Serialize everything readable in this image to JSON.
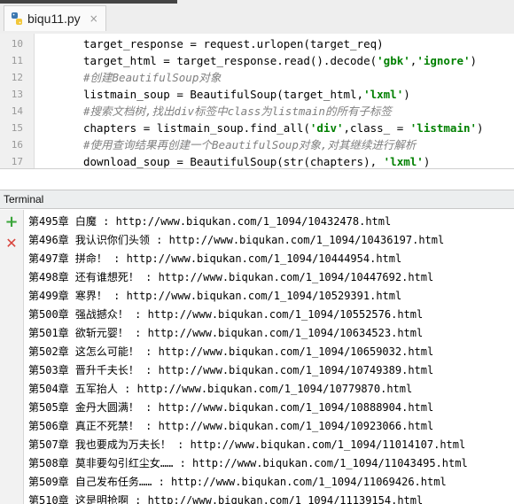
{
  "tab": {
    "filename": "biqu11.py",
    "close_symbol": "×"
  },
  "editor": {
    "lines": [
      {
        "num": "10",
        "parts": [
          {
            "t": "target_response = request.urlopen(target_req)",
            "k": "fn"
          }
        ]
      },
      {
        "num": "11",
        "parts": [
          {
            "t": "target_html = target_response.read().decode(",
            "k": "fn"
          },
          {
            "t": "'gbk'",
            "k": "s"
          },
          {
            "t": ",",
            "k": "fn"
          },
          {
            "t": "'ignore'",
            "k": "s"
          },
          {
            "t": ")",
            "k": "fn"
          }
        ]
      },
      {
        "num": "12",
        "parts": [
          {
            "t": "#创建BeautifulSoup对象",
            "k": "c"
          }
        ]
      },
      {
        "num": "13",
        "parts": [
          {
            "t": "listmain_soup = BeautifulSoup(target_html,",
            "k": "fn"
          },
          {
            "t": "'lxml'",
            "k": "s"
          },
          {
            "t": ")",
            "k": "fn"
          }
        ]
      },
      {
        "num": "14",
        "parts": [
          {
            "t": "#搜索文档树,找出div标签中class为listmain的所有子标签",
            "k": "c"
          }
        ]
      },
      {
        "num": "15",
        "parts": [
          {
            "t": "chapters = listmain_soup.find_all(",
            "k": "fn"
          },
          {
            "t": "'div'",
            "k": "s"
          },
          {
            "t": ",class_ = ",
            "k": "fn"
          },
          {
            "t": "'listmain'",
            "k": "s"
          },
          {
            "t": ")",
            "k": "fn"
          }
        ]
      },
      {
        "num": "16",
        "parts": [
          {
            "t": "#使用查询结果再创建一个BeautifulSoup对象,对其继续进行解析",
            "k": "c"
          }
        ]
      },
      {
        "num": "17",
        "parts": [
          {
            "t": "download_soup = BeautifulSoup(str(chapters), ",
            "k": "fn"
          },
          {
            "t": "'lxml'",
            "k": "s"
          },
          {
            "t": ")",
            "k": "fn"
          }
        ]
      }
    ]
  },
  "terminal": {
    "title": "Terminal",
    "add_symbol": "+",
    "close_symbol": "✕",
    "rows": [
      "第495章 白魔 : http://www.biqukan.com/1_1094/10432478.html",
      "第496章 我认识你们头领 : http://www.biqukan.com/1_1094/10436197.html",
      "第497章 拼命！ : http://www.biqukan.com/1_1094/10444954.html",
      "第498章 还有谁想死！ : http://www.biqukan.com/1_1094/10447692.html",
      "第499章 寒界！ : http://www.biqukan.com/1_1094/10529391.html",
      "第500章 强战撼众！ : http://www.biqukan.com/1_1094/10552576.html",
      "第501章 欲斩元婴！ : http://www.biqukan.com/1_1094/10634523.html",
      "第502章 这怎么可能！ : http://www.biqukan.com/1_1094/10659032.html",
      "第503章 晋升千夫长！ : http://www.biqukan.com/1_1094/10749389.html",
      "第504章 五军抬人 : http://www.biqukan.com/1_1094/10779870.html",
      "第505章 金丹大圆满！ : http://www.biqukan.com/1_1094/10888904.html",
      "第506章 真正不死禁！ : http://www.biqukan.com/1_1094/10923066.html",
      "第507章 我也要成为万夫长！ : http://www.biqukan.com/1_1094/11014107.html",
      "第508章 莫非要勾引红尘女…… : http://www.biqukan.com/1_1094/11043495.html",
      "第509章 自己发布任务…… : http://www.biqukan.com/1_1094/11069426.html",
      "第510章 这是明抢啊 : http://www.biqukan.com/1_1094/11139154.html"
    ]
  }
}
